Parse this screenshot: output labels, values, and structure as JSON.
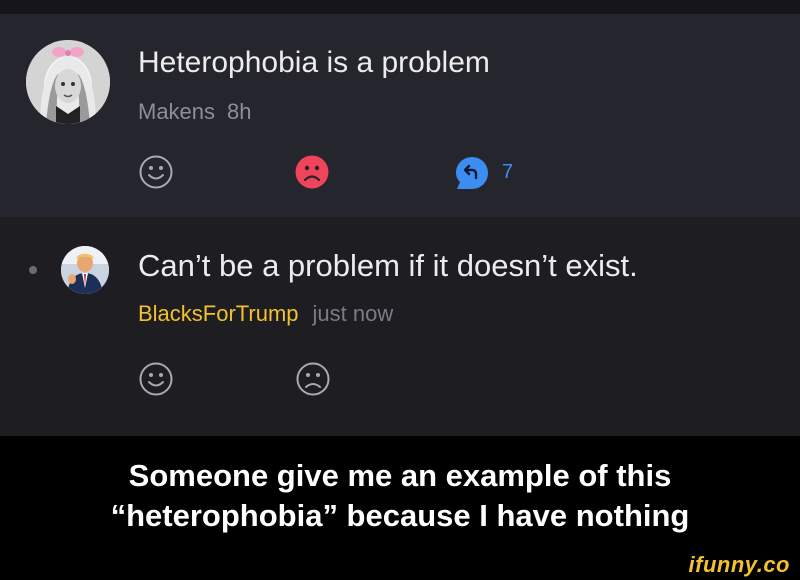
{
  "post": {
    "title": "Heterophobia is a problem",
    "username": "Makens",
    "time": "8h",
    "reply_count": "7"
  },
  "reply": {
    "text": "Can’t be a problem if it doesn’t exist.",
    "username": "BlacksForTrump",
    "time": "just now"
  },
  "caption": {
    "line1": "Someone give me an example of this",
    "line2": "“heterophobia” because I have nothing"
  },
  "watermark": "ifunny.co",
  "colors": {
    "username_accent": "#f2c12e",
    "dislike_active": "#f0445a",
    "reply_accent": "#3d8cf0",
    "post_bg": "#25252d",
    "reply_bg": "#1d1d22"
  }
}
